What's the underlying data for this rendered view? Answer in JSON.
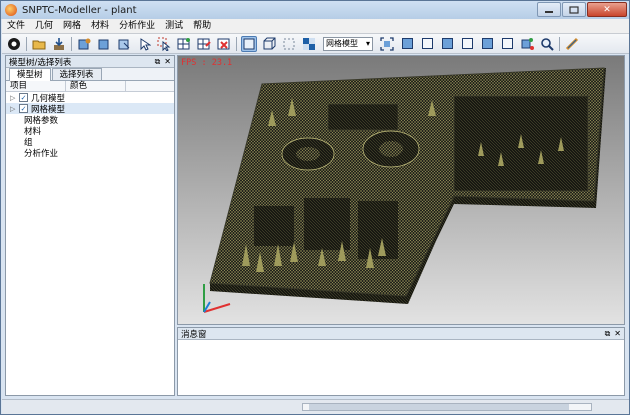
{
  "window": {
    "title": "SNPTC-Modeller - plant",
    "min_icon": "minimize-icon",
    "max_icon": "maximize-icon",
    "close_glyph": "✕"
  },
  "menu": [
    "文件",
    "几何",
    "网格",
    "材料",
    "分析作业",
    "测试",
    "帮助"
  ],
  "toolbar": {
    "display_mode": "网格模型"
  },
  "model_panel": {
    "title": "模型树/选择列表",
    "tabs": [
      "模型树",
      "选择列表"
    ],
    "columns": [
      "项目",
      "颜色"
    ],
    "tree": [
      {
        "label": "几何模型",
        "checked": true,
        "expandable": true
      },
      {
        "label": "网格模型",
        "checked": true,
        "expandable": true,
        "selected": true
      },
      {
        "label": "网格参数"
      },
      {
        "label": "材料"
      },
      {
        "label": "组"
      },
      {
        "label": "分析作业"
      }
    ]
  },
  "viewport": {
    "fps": "FPS : 23.1"
  },
  "message_panel": {
    "title": "消息窗"
  },
  "colors": {
    "accent": "#4c7bb3",
    "fps_text": "#e03131",
    "mesh": "#b9b56a",
    "mesh_dark": "#23231c"
  }
}
